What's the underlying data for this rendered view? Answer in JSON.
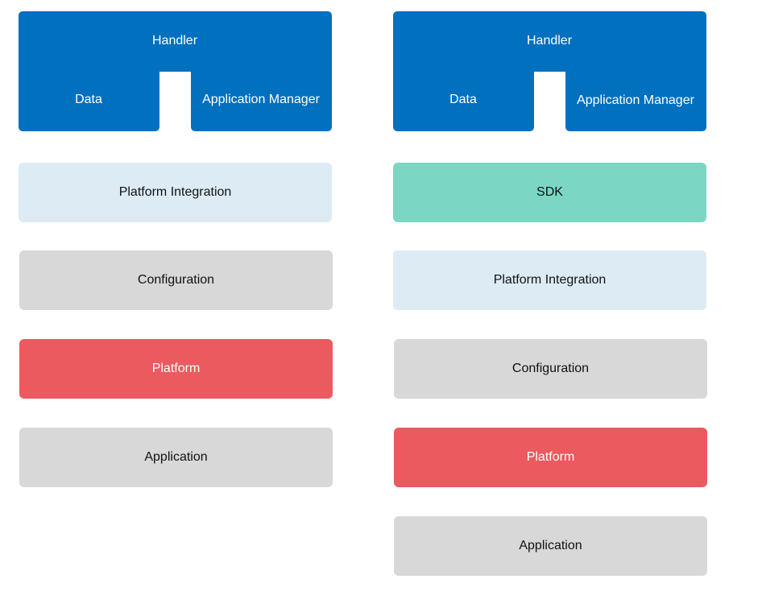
{
  "colors": {
    "blue": "#0070BF",
    "light_blue": "#DDEBF5",
    "teal": "#7CD6C4",
    "gray": "#D8D8D8",
    "red": "#EA5A5F"
  },
  "left_stack": {
    "top": {
      "handler": "Handler",
      "data": "Data",
      "app_manager": "Application Manager"
    },
    "layers": [
      {
        "label": "Platform Integration",
        "color": "light_blue"
      },
      {
        "label": "Configuration",
        "color": "gray"
      },
      {
        "label": "Platform",
        "color": "red"
      },
      {
        "label": "Application",
        "color": "gray"
      }
    ]
  },
  "right_stack": {
    "top": {
      "handler": "Handler",
      "data": "Data",
      "app_manager": "Application Manager"
    },
    "layers": [
      {
        "label": "SDK",
        "color": "teal"
      },
      {
        "label": "Platform Integration",
        "color": "light_blue"
      },
      {
        "label": "Configuration",
        "color": "gray"
      },
      {
        "label": "Platform",
        "color": "red"
      },
      {
        "label": "Application",
        "color": "gray"
      }
    ]
  }
}
